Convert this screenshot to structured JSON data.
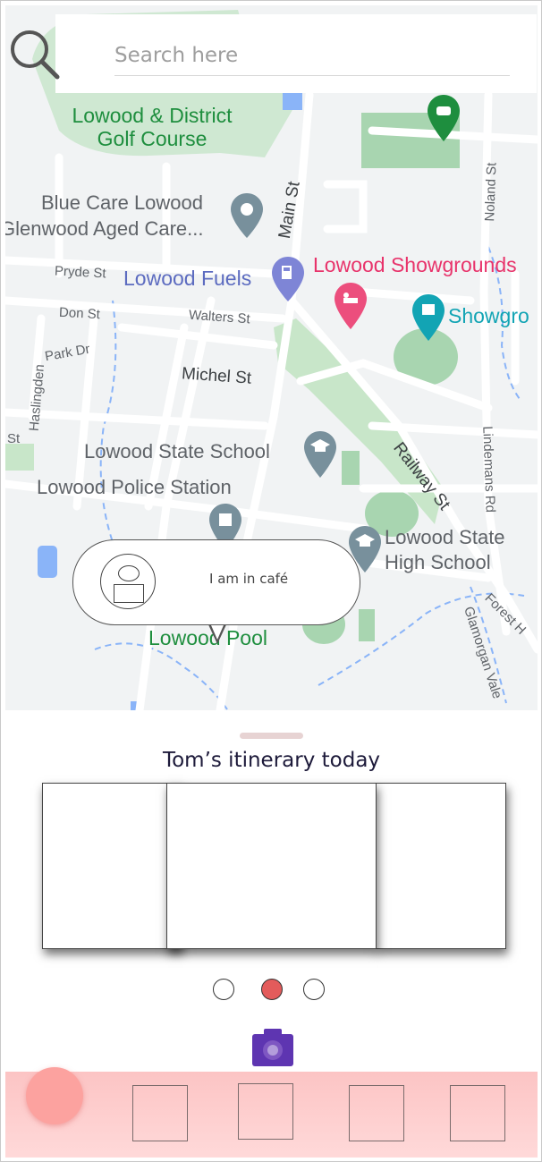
{
  "search": {
    "placeholder": "Search here"
  },
  "map": {
    "labels": {
      "golf_line1": "Lowood & District",
      "golf_line2": "Golf Course",
      "bluecare_line1": "Blue Care Lowood",
      "bluecare_line2": "Glenwood Aged Care...",
      "fuels": "Lowood Fuels",
      "showgrounds": "Lowood Showgrounds",
      "showgro": "Showgro",
      "pryde": "Pryde St",
      "don": "Don St",
      "walters": "Walters St",
      "park": "Park Dr",
      "haslingden": "Haslingden",
      "michel": "Michel St",
      "main": "Main St",
      "noland": "Noland St",
      "st_left": "St",
      "state_school": "Lowood State School",
      "police": "Lowood Police Station",
      "railway": "Railway St",
      "lindemans": "Lindemans Rd",
      "high_school_line1": "Lowood State",
      "high_school_line2": "High School",
      "forest": "Forest H",
      "glamorgan": "Glamorgan Vale",
      "pool": "Lowood Pool"
    }
  },
  "status": {
    "text": "I am in café"
  },
  "itinerary": {
    "title": "Tom’s itinerary today",
    "pager": {
      "count": 3,
      "active": 1
    }
  },
  "colors": {
    "map_bg": "#f1f3f4",
    "park": "#c8e6c9",
    "water": "#8ab4f8",
    "road": "#ffffff",
    "active_dot": "#e35b5b",
    "camera": "#5e35b1",
    "nav_bg": "#fcc4c4",
    "fab": "#fca29f"
  }
}
